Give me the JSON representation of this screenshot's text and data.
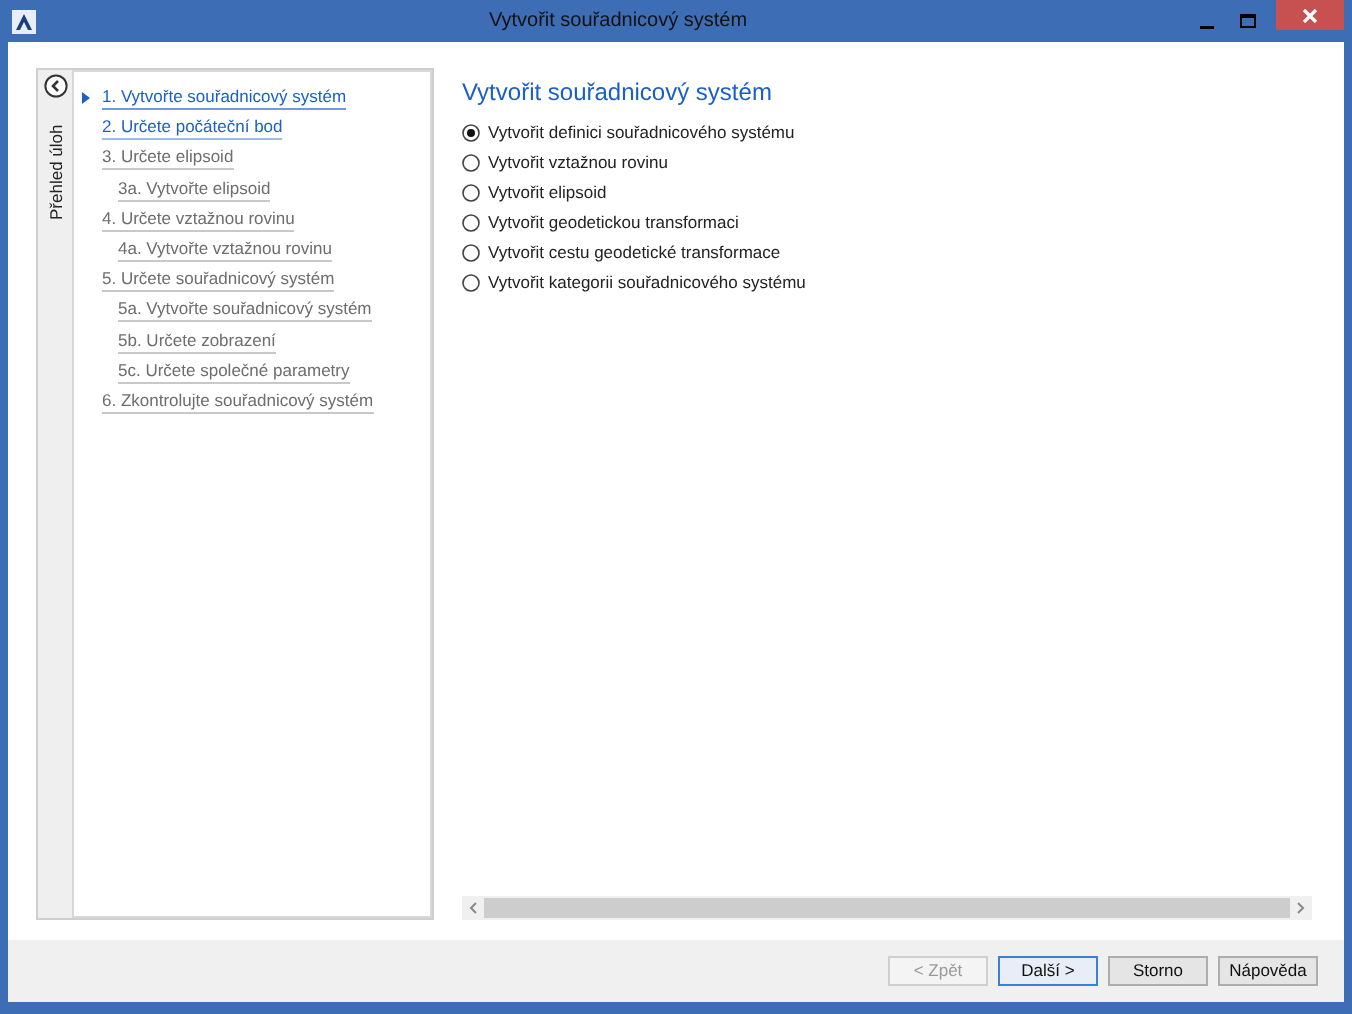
{
  "window": {
    "title": "Vytvořit souřadnicový systém"
  },
  "sidebar": {
    "tab_label": "Přehled úloh",
    "steps": [
      {
        "label": "1. Vytvořte souřadnicový systém",
        "enabled": true,
        "selected": true
      },
      {
        "label": "2. Určete počáteční bod",
        "enabled": true,
        "selected": false
      },
      {
        "label": "3. Určete elipsoid",
        "enabled": false,
        "selected": false,
        "children": [
          {
            "label": "3a. Vytvořte elipsoid",
            "enabled": false,
            "selected": false
          }
        ]
      },
      {
        "label": "4. Určete vztažnou rovinu",
        "enabled": false,
        "selected": false,
        "children": [
          {
            "label": "4a. Vytvořte vztažnou rovinu",
            "enabled": false,
            "selected": false
          }
        ]
      },
      {
        "label": "5. Určete souřadnicový systém",
        "enabled": false,
        "selected": false,
        "children": [
          {
            "label": "5a. Vytvořte souřadnicový systém",
            "enabled": false,
            "selected": false
          },
          {
            "label": "5b. Určete zobrazení",
            "enabled": false,
            "selected": false
          },
          {
            "label": "5c. Určete společné parametry",
            "enabled": false,
            "selected": false
          }
        ]
      },
      {
        "label": "6. Zkontrolujte souřadnicový systém",
        "enabled": false,
        "selected": false
      }
    ]
  },
  "content": {
    "heading": "Vytvořit souřadnicový systém",
    "options": [
      {
        "label": "Vytvořit definici souřadnicového systému",
        "selected": true
      },
      {
        "label": "Vytvořit vztažnou rovinu",
        "selected": false
      },
      {
        "label": "Vytvořit elipsoid",
        "selected": false
      },
      {
        "label": "Vytvořit geodetickou transformaci",
        "selected": false
      },
      {
        "label": "Vytvořit cestu geodetické transformace",
        "selected": false
      },
      {
        "label": "Vytvořit kategorii souřadnicového systému",
        "selected": false
      }
    ]
  },
  "buttons": [
    {
      "label": "< Zpět",
      "disabled": true,
      "default": false
    },
    {
      "label": "Další >",
      "disabled": false,
      "default": true
    },
    {
      "label": "Storno",
      "disabled": false,
      "default": false
    },
    {
      "label": "Nápověda",
      "disabled": false,
      "default": false
    }
  ]
}
